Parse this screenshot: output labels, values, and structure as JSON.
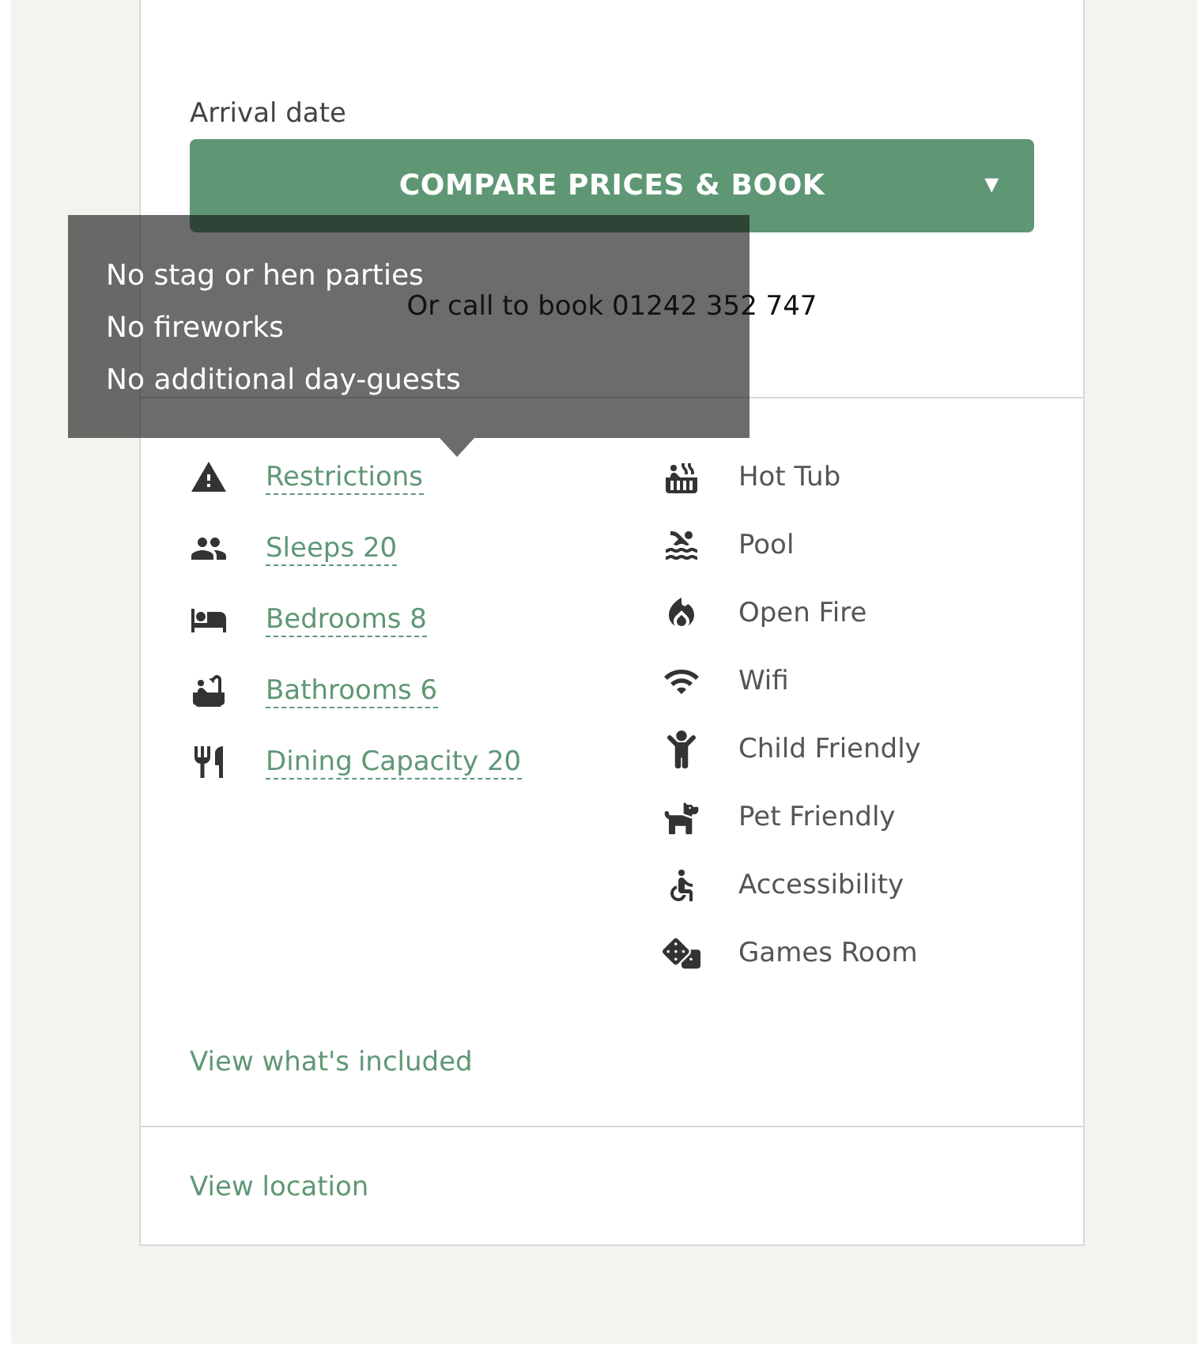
{
  "booking": {
    "label": "Arrival date",
    "button": "COMPARE PRICES & BOOK",
    "button_caret": "▾",
    "call_text": "Or call to book 01242 352 747"
  },
  "tooltip": {
    "lines": [
      "No stag or hen parties",
      "No fireworks",
      "No additional day-guests"
    ]
  },
  "details": [
    {
      "label": "Restrictions"
    },
    {
      "label": "Sleeps 20"
    },
    {
      "label": "Bedrooms 8"
    },
    {
      "label": "Bathrooms 6"
    },
    {
      "label": "Dining Capacity 20"
    }
  ],
  "amenities": [
    {
      "label": "Hot Tub"
    },
    {
      "label": "Pool"
    },
    {
      "label": "Open Fire"
    },
    {
      "label": "Wifi"
    },
    {
      "label": "Child Friendly"
    },
    {
      "label": "Pet Friendly"
    },
    {
      "label": "Accessibility"
    },
    {
      "label": "Games Room"
    }
  ],
  "links": [
    {
      "label": "View what's included"
    },
    {
      "label": "View location"
    }
  ]
}
